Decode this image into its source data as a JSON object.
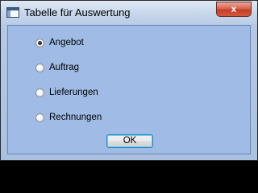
{
  "window": {
    "title": "Tabelle für Auswertung",
    "close_symbol": "x",
    "app_icon": "table-window-icon"
  },
  "options": [
    {
      "label": "Angebot",
      "checked": true
    },
    {
      "label": "Auftrag",
      "checked": false
    },
    {
      "label": "Lieferungen",
      "checked": false
    },
    {
      "label": "Rechnungen",
      "checked": false
    }
  ],
  "buttons": {
    "ok_label": "OK"
  },
  "colors": {
    "client_background": "#a0bce6",
    "close_button": "#c43d25",
    "focus_ring": "#5fd0f7"
  }
}
